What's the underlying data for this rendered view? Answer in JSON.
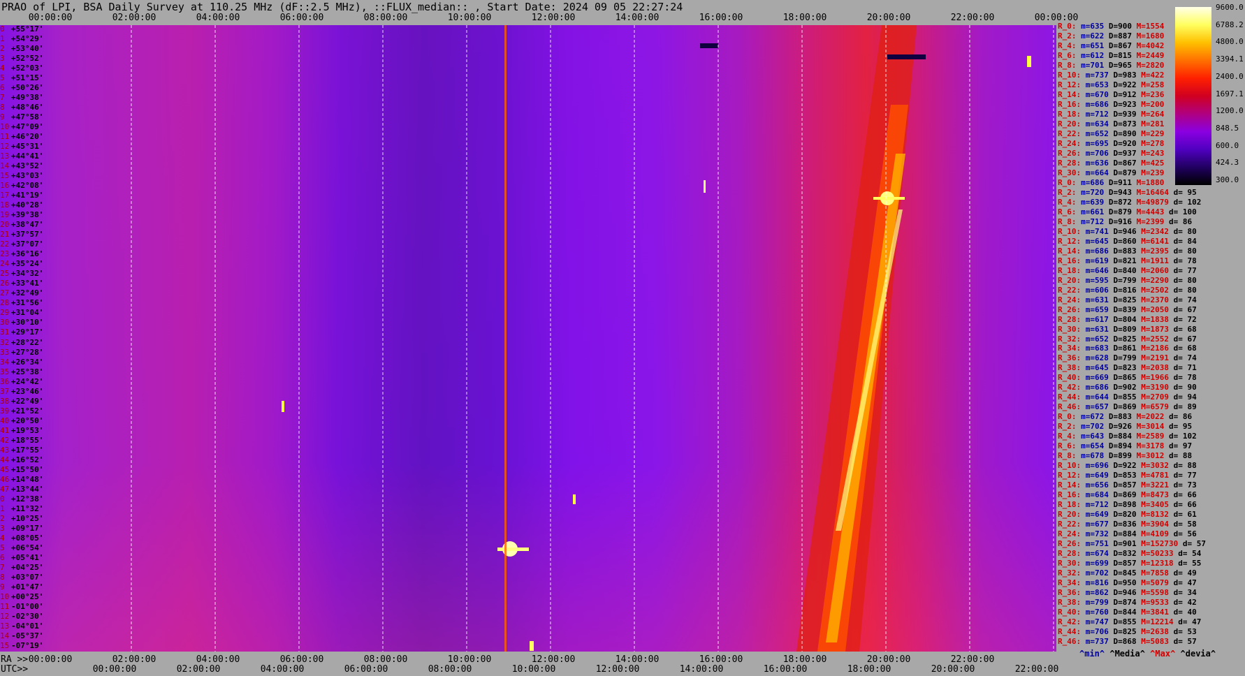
{
  "title": "PRAO of LPI, BSA Daily Survey at 110.25 MHz (dF::2.5 MHz), ::FLUX_median:: , Start Date: 2024 09 05 22:27:24",
  "x_axis": {
    "row_labels": {
      "ra": "RA >>",
      "utc": "UTC>>"
    },
    "top_ticks": [
      "00:00:00",
      "02:00:00",
      "04:00:00",
      "06:00:00",
      "08:00:00",
      "10:00:00",
      "12:00:00",
      "14:00:00",
      "16:00:00",
      "18:00:00",
      "20:00:00",
      "22:00:00",
      "00:00:00"
    ],
    "ra_ticks": [
      "00:00:00",
      "02:00:00",
      "04:00:00",
      "06:00:00",
      "08:00:00",
      "10:00:00",
      "12:00:00",
      "14:00:00",
      "16:00:00",
      "18:00:00",
      "20:00:00",
      "22:00:00"
    ],
    "utc_ticks": [
      "00:00:00",
      "02:00:00",
      "04:00:00",
      "06:00:00",
      "08:00:00",
      "10:00:00",
      "12:00:00",
      "14:00:00",
      "16:00:00",
      "18:00:00",
      "20:00:00",
      "22:00:00"
    ]
  },
  "chart_data": {
    "type": "heatmap",
    "title": "PRAO of LPI, BSA Daily Survey at 110.25 MHz (dF::2.5 MHz), ::FLUX_median:: , Start Date: 2024 09 05 22:27:24",
    "x_range_hours": [
      0,
      24
    ],
    "grid": true,
    "declinations": [
      "+55°17'",
      "+54°29'",
      "+53°40'",
      "+52°52'",
      "+52°03'",
      "+51°15'",
      "+50°26'",
      "+49°38'",
      "+48°46'",
      "+47°58'",
      "+47°09'",
      "+46°20'",
      "+45°31'",
      "+44°41'",
      "+43°52'",
      "+43°03'",
      "+42°08'",
      "+41°19'",
      "+40°28'",
      "+39°38'",
      "+38°47'",
      "+37°57'",
      "+37°07'",
      "+36°16'",
      "+35°24'",
      "+34°32'",
      "+33°41'",
      "+32°49'",
      "+31°56'",
      "+31°04'",
      "+30°10'",
      "+29°17'",
      "+28°22'",
      "+27°28'",
      "+26°34'",
      "+25°38'",
      "+24°42'",
      "+23°46'",
      "+22°49'",
      "+21°52'",
      "+20°50'",
      "+19°53'",
      "+18°55'",
      "+17°55'",
      "+16°52'",
      "+15°50'",
      "+14°48'",
      "+13°44'",
      "+12°38'",
      "+11°32'",
      "+10°25'",
      "+09°17'",
      "+08°05'",
      "+06°54'",
      "+05°41'",
      "+04°25'",
      "+03°07'",
      "+01°47'",
      "+00°25'",
      "-01°00'",
      "-02°30'",
      "-04°01'",
      "-05°37'",
      "-07°19'"
    ],
    "colorbar": {
      "ticks": [
        9600.0,
        6788.2,
        4800.0,
        3394.1,
        2400.0,
        1697.1,
        1200.0,
        848.5,
        600.0,
        424.3,
        300.0
      ],
      "colors": [
        "#ffffe8",
        "#ffff60",
        "#ffc000",
        "#ff7000",
        "#ff2000",
        "#d00020",
        "#b00080",
        "#8a00e0",
        "#5000c0",
        "#200060",
        "#000000"
      ]
    },
    "stats": [
      [
        "R_0:",
        635,
        900,
        1554,
        null
      ],
      [
        "R_2:",
        622,
        887,
        1680,
        null
      ],
      [
        "R_4:",
        651,
        867,
        4042,
        null
      ],
      [
        "R_6:",
        612,
        815,
        2449,
        null
      ],
      [
        "R_8:",
        701,
        965,
        2820,
        null
      ],
      [
        "R_10:",
        737,
        983,
        422,
        null
      ],
      [
        "R_12:",
        653,
        922,
        258,
        null
      ],
      [
        "R_14:",
        670,
        912,
        236,
        null
      ],
      [
        "R_16:",
        686,
        923,
        200,
        null
      ],
      [
        "R_18:",
        712,
        939,
        264,
        null
      ],
      [
        "R_20:",
        634,
        873,
        281,
        null
      ],
      [
        "R_22:",
        652,
        890,
        229,
        null
      ],
      [
        "R_24:",
        695,
        920,
        278,
        null
      ],
      [
        "R_26:",
        706,
        937,
        243,
        null
      ],
      [
        "R_28:",
        636,
        867,
        425,
        null
      ],
      [
        "R_30:",
        664,
        879,
        239,
        null
      ],
      [
        "R_0:",
        686,
        911,
        1880,
        null
      ],
      [
        "R_2:",
        720,
        943,
        16464,
        95
      ],
      [
        "R_4:",
        639,
        872,
        49879,
        102
      ],
      [
        "R_6:",
        661,
        879,
        4443,
        100
      ],
      [
        "R_8:",
        712,
        916,
        2399,
        86
      ],
      [
        "R_10:",
        741,
        946,
        2342,
        80
      ],
      [
        "R_12:",
        645,
        860,
        6141,
        84
      ],
      [
        "R_14:",
        686,
        883,
        2395,
        80
      ],
      [
        "R_16:",
        619,
        821,
        1911,
        78
      ],
      [
        "R_18:",
        646,
        840,
        2060,
        77
      ],
      [
        "R_20:",
        595,
        799,
        2290,
        80
      ],
      [
        "R_22:",
        606,
        816,
        2502,
        80
      ],
      [
        "R_24:",
        631,
        825,
        2370,
        74
      ],
      [
        "R_26:",
        659,
        839,
        2050,
        67
      ],
      [
        "R_28:",
        617,
        804,
        1838,
        72
      ],
      [
        "R_30:",
        631,
        809,
        1873,
        68
      ],
      [
        "R_32:",
        652,
        825,
        2552,
        67
      ],
      [
        "R_34:",
        683,
        861,
        2186,
        68
      ],
      [
        "R_36:",
        628,
        799,
        2191,
        74
      ],
      [
        "R_38:",
        645,
        823,
        2038,
        71
      ],
      [
        "R_40:",
        669,
        865,
        1966,
        78
      ],
      [
        "R_42:",
        686,
        902,
        3190,
        90
      ],
      [
        "R_44:",
        644,
        855,
        2709,
        94
      ],
      [
        "R_46:",
        657,
        869,
        6579,
        89
      ],
      [
        "R_0:",
        672,
        883,
        2022,
        86
      ],
      [
        "R_2:",
        702,
        926,
        3014,
        95
      ],
      [
        "R_4:",
        643,
        884,
        2589,
        102
      ],
      [
        "R_6:",
        654,
        894,
        3178,
        97
      ],
      [
        "R_8:",
        678,
        899,
        3012,
        88
      ],
      [
        "R_10:",
        696,
        922,
        3032,
        88
      ],
      [
        "R_12:",
        649,
        853,
        4781,
        77
      ],
      [
        "R_14:",
        656,
        857,
        3221,
        73
      ],
      [
        "R_16:",
        684,
        869,
        8473,
        66
      ],
      [
        "R_18:",
        712,
        898,
        3405,
        66
      ],
      [
        "R_20:",
        649,
        820,
        8132,
        61
      ],
      [
        "R_22:",
        677,
        836,
        3904,
        58
      ],
      [
        "R_24:",
        732,
        884,
        4109,
        56
      ],
      [
        "R_26:",
        751,
        901,
        152730,
        57
      ],
      [
        "R_28:",
        674,
        832,
        50233,
        54
      ],
      [
        "R_30:",
        699,
        857,
        12318,
        55
      ],
      [
        "R_32:",
        702,
        845,
        7858,
        49
      ],
      [
        "R_34:",
        816,
        950,
        5079,
        47
      ],
      [
        "R_36:",
        862,
        946,
        5598,
        34
      ],
      [
        "R_38:",
        799,
        874,
        9533,
        42
      ],
      [
        "R_40:",
        760,
        844,
        3841,
        40
      ],
      [
        "R_42:",
        747,
        855,
        12214,
        47
      ],
      [
        "R_44:",
        706,
        825,
        2638,
        53
      ],
      [
        "R_46:",
        737,
        868,
        5083,
        57
      ]
    ]
  },
  "legend": {
    "min": "^min^",
    "median": "^Media^",
    "max": "^Max^",
    "devia": "^devia^"
  }
}
